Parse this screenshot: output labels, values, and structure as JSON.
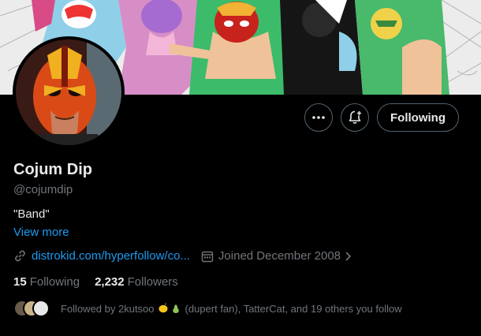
{
  "profile": {
    "name": "Cojum Dip",
    "handle": "@cojumdip",
    "bio": "\"Band\"",
    "view_more": "View more",
    "link": "distrokid.com/hyperfollow/co...",
    "joined": "Joined December 2008"
  },
  "actions": {
    "more_icon": "more-icon",
    "notify_icon": "bell-plus-icon",
    "follow_label": "Following"
  },
  "stats": {
    "following_count": "15",
    "following_label": "Following",
    "followers_count": "2,232",
    "followers_label": "Followers"
  },
  "followed_by": {
    "prefix": "Followed by 2kutsoo",
    "suffix": "(dupert fan), TatterCat, and 19 others you follow"
  },
  "colors": {
    "accent": "#1d9bf0",
    "background": "#000000",
    "secondary_text": "#71767b",
    "primary_text": "#e7e9ea"
  }
}
